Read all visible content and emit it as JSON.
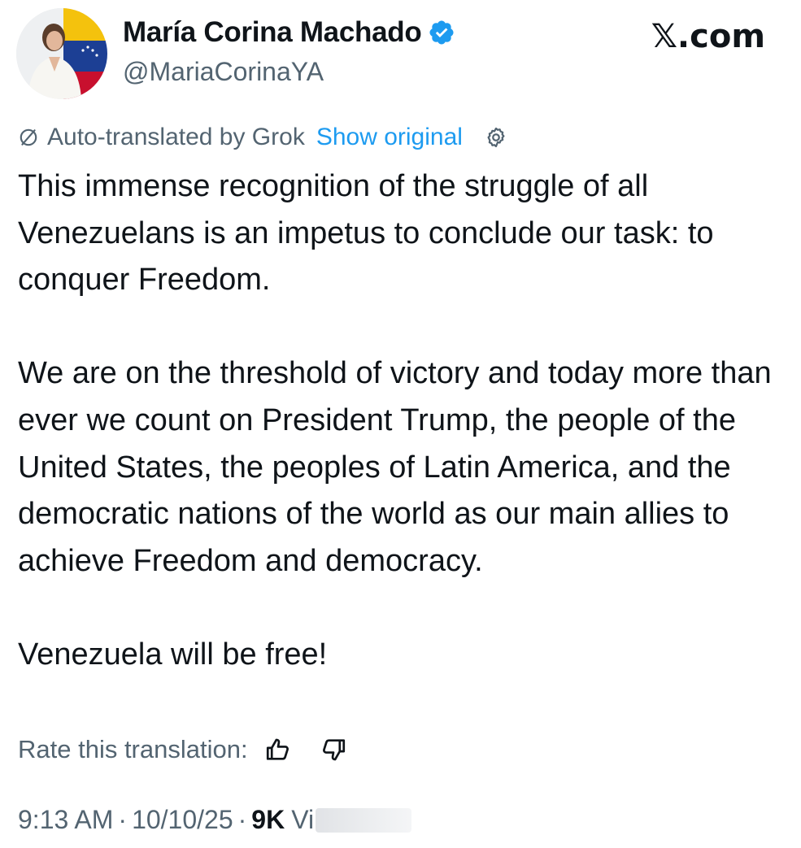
{
  "author": {
    "display_name": "María Corina Machado",
    "handle": "@MariaCorinaYA",
    "avatar_icon": "profile-photo",
    "verified_icon": "verified-badge-icon",
    "verified_color": "#1d9bf0"
  },
  "site_label": "𝕏.com",
  "translation": {
    "label": "Auto-translated by Grok",
    "show_original": "Show original",
    "icon": "translate-icon",
    "settings_icon": "gear-icon"
  },
  "tweet": {
    "paragraphs": [
      "This immense recognition of the struggle of all Venezuelans is an impetus to conclude our task: to conquer Freedom.",
      "We are on the threshold of victory and today more than ever we count on President Trump, the people of the United States, the peoples of Latin America, and the democratic nations of the world as our main allies to achieve Freedom and democracy.",
      "Venezuela will be free!"
    ]
  },
  "rating": {
    "label": "Rate this translation:",
    "up_icon": "thumbs-up-icon",
    "down_icon": "thumbs-down-icon"
  },
  "meta": {
    "time": "9:13 AM",
    "separator": "·",
    "date": "10/10/25",
    "views_count": "9K",
    "views_label": "Vi"
  },
  "colors": {
    "text": "#0f1419",
    "secondary": "#536471",
    "link": "#1d9bf0"
  }
}
